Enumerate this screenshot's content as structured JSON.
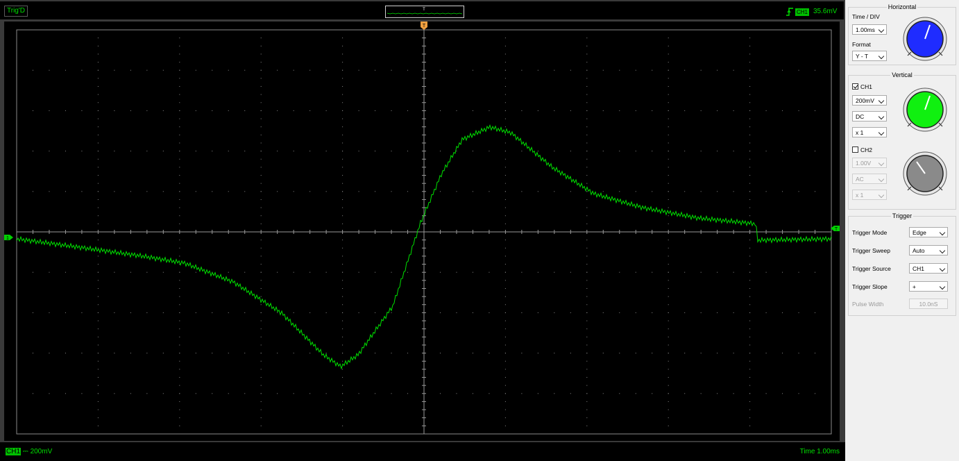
{
  "top_bar": {
    "trigger_state": "Trig'D",
    "mini_marker": "T",
    "channel_badge": "CH1",
    "trigger_level": "35.6mV"
  },
  "screen": {
    "trigger_marker": "T",
    "ch1_marker": "1",
    "trigger_level_marker": "T"
  },
  "bottom_bar": {
    "ch1_badge": "CH1",
    "ch1_scale": "200mV",
    "time_scale": "Time 1.00ms"
  },
  "horizontal": {
    "title": "Horizontal",
    "time_div_label": "Time / DIV",
    "time_div_value": "1.00ms",
    "format_label": "Format",
    "format_value": "Y - T",
    "knob_color": "#1f2cff"
  },
  "vertical": {
    "title": "Vertical",
    "ch1": {
      "label": "CH1",
      "checked": true,
      "volts": "200mV",
      "coupling": "DC",
      "probe": "x 1",
      "knob_color": "#10f010"
    },
    "ch2": {
      "label": "CH2",
      "checked": false,
      "volts": "1.00V",
      "coupling": "AC",
      "probe": "x 1",
      "knob_color": "#8a8a8a"
    }
  },
  "trigger": {
    "title": "Trigger",
    "mode_label": "Trigger Mode",
    "mode_value": "Edge",
    "sweep_label": "Trigger Sweep",
    "sweep_value": "Auto",
    "source_label": "Trigger Source",
    "source_value": "CH1",
    "slope_label": "Trigger Slope",
    "slope_value": "+",
    "pulse_label": "Pulse Width",
    "pulse_value": "10.0nS"
  },
  "colors": {
    "trace": "#00e000",
    "trigger_marker": "#f0a040",
    "grid": "#7a7a7a"
  }
}
